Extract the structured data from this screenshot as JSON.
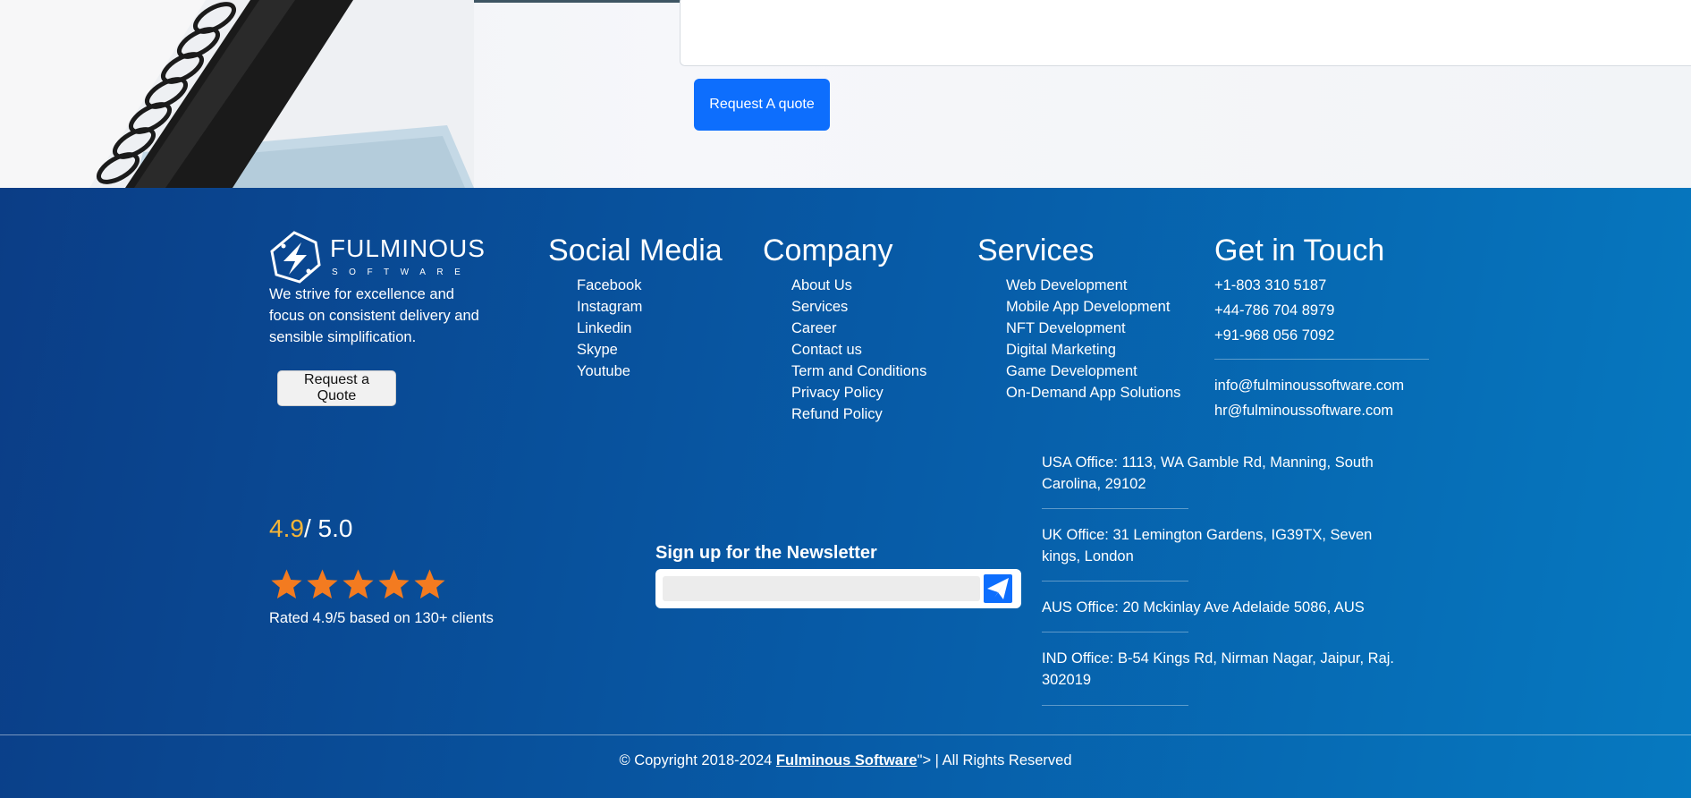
{
  "hero": {
    "quote_button": "Request A quote"
  },
  "brand": {
    "logo_name": "FULMINOUS",
    "logo_sub": "SOFTWARE",
    "tagline": "We strive for excellence and focus on consistent delivery and sensible simplification.",
    "request_button": "Request a Quote"
  },
  "social": {
    "title": "Social Media",
    "items": [
      "Facebook",
      "Instagram",
      "Linkedin",
      "Skype",
      "Youtube"
    ]
  },
  "company": {
    "title": "Company",
    "items": [
      "About Us",
      "Services",
      "Career",
      "Contact us",
      "Term and Conditions",
      "Privacy Policy",
      "Refund Policy"
    ]
  },
  "services": {
    "title": "Services",
    "items": [
      "Web Development",
      "Mobile App Development",
      "NFT Development",
      "Digital Marketing",
      "Game Development",
      "On-Demand App Solutions"
    ]
  },
  "contact": {
    "title": "Get in Touch",
    "phones": [
      "+1-803 310 5187",
      "+44-786 704 8979",
      "+91-968 056 7092"
    ],
    "emails": [
      "info@fulminoussoftware.com",
      "hr@fulminoussoftware.com"
    ]
  },
  "rating": {
    "score": "4.9",
    "max": "/ 5.0",
    "stars": 5,
    "text": "Rated 4.9/5 based on 130+ clients",
    "star_color": "#f37b20"
  },
  "newsletter": {
    "title": "Sign up for the Newsletter",
    "placeholder": ""
  },
  "offices": [
    "USA Office: 1113, WA Gamble Rd, Manning, South Carolina, 29102",
    "UK Office: 31 Lemington Gardens, IG39TX, Seven kings, London",
    "AUS Office: 20 Mckinlay Ave Adelaide 5086, AUS",
    "IND Office: B-54 Kings Rd, Nirman Nagar, Jaipur, Raj. 302019"
  ],
  "copyright": {
    "prefix": "© Copyright 2018-2024 ",
    "company": "Fulminous Software",
    "suffix": "\"> | All Rights Reserved"
  },
  "colors": {
    "primary_button": "#0d6efd",
    "footer_start": "#0b3d86",
    "footer_end": "#0679c0",
    "rating_score": "#f6b436"
  }
}
